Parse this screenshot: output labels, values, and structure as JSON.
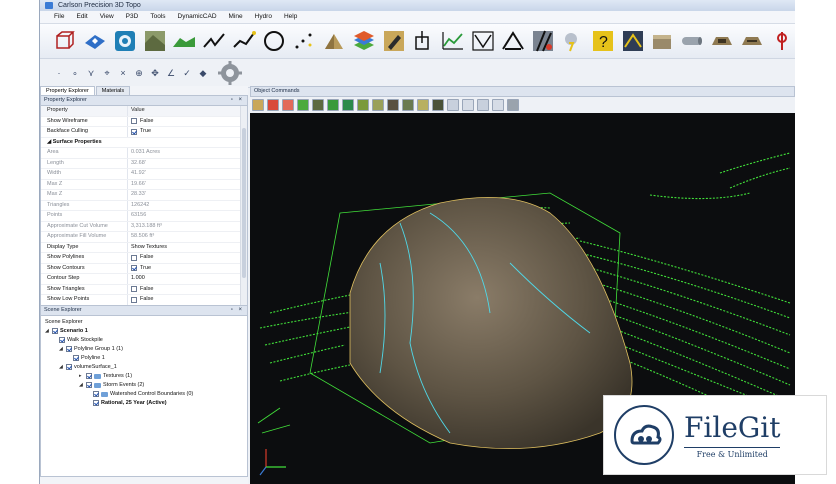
{
  "window": {
    "title": "Carlson Precision 3D Topo"
  },
  "menu": [
    "File",
    "Edit",
    "View",
    "P3D",
    "Tools",
    "DynamicCAD",
    "Mine",
    "Hydro",
    "Help"
  ],
  "left_tabs": [
    "Property Explorer",
    "Materials"
  ],
  "property_explorer": {
    "title": "Property Explorer",
    "header": {
      "name": "Property",
      "value": "Value"
    },
    "rows": [
      {
        "name": "Show Wireframe",
        "value": "False",
        "checked": false,
        "dim": false
      },
      {
        "name": "Backface Culling",
        "value": "True",
        "checked": true,
        "dim": false
      }
    ],
    "section": "Surface Properties",
    "surface_rows": [
      {
        "name": "Area",
        "value": "0.031 Acres",
        "dim": true
      },
      {
        "name": "Length",
        "value": "32.68'",
        "dim": true
      },
      {
        "name": "Width",
        "value": "41.92'",
        "dim": true
      },
      {
        "name": "Max Z",
        "value": "19.66'",
        "dim": true
      },
      {
        "name": "Max Z",
        "value": "28.33'",
        "dim": true
      },
      {
        "name": "Triangles",
        "value": "126242",
        "dim": true
      },
      {
        "name": "Points",
        "value": "63156",
        "dim": true
      },
      {
        "name": "Approximate Cut Volume",
        "value": "3,313.188 ft³",
        "dim": true
      },
      {
        "name": "Approximate Fill Volume",
        "value": "58.506 ft³",
        "dim": true
      },
      {
        "name": "Display Type",
        "value": "Show Textures",
        "dim": false
      },
      {
        "name": "Show Polylines",
        "value": "False",
        "checked": false,
        "dim": false
      },
      {
        "name": "Show Contours",
        "value": "True",
        "checked": true,
        "dim": false
      },
      {
        "name": "Contour Step",
        "value": "1.000",
        "dim": false
      },
      {
        "name": "Show Triangles",
        "value": "False",
        "checked": false,
        "dim": false
      },
      {
        "name": "Show Low Points",
        "value": "False",
        "checked": false,
        "dim": false
      }
    ]
  },
  "scene_explorer": {
    "title": "Scene Explorer",
    "items": [
      {
        "label": "Scene Explorer"
      },
      {
        "label": "Scenario 1"
      },
      {
        "label": "Walk Stockpile"
      },
      {
        "label": "Polyline Group 1 (1)"
      },
      {
        "label": "Polyline 1"
      },
      {
        "label": "volumeSurface_1"
      },
      {
        "label": "Textures (1)"
      },
      {
        "label": "Storm Events (2)"
      },
      {
        "label": "Watershed Control Boundaries (0)"
      },
      {
        "label": "Rational, 25 Year (Active)"
      }
    ]
  },
  "object_commands": {
    "title": "Object Commands"
  },
  "watermark": {
    "name": "FileGit",
    "tagline": "Free & Unlimited"
  },
  "colors": {
    "contour": "#41e03a",
    "viewport_bg": "#0c0d0f",
    "stockpile": "#6b5f4e",
    "brand": "#1f3e66"
  }
}
